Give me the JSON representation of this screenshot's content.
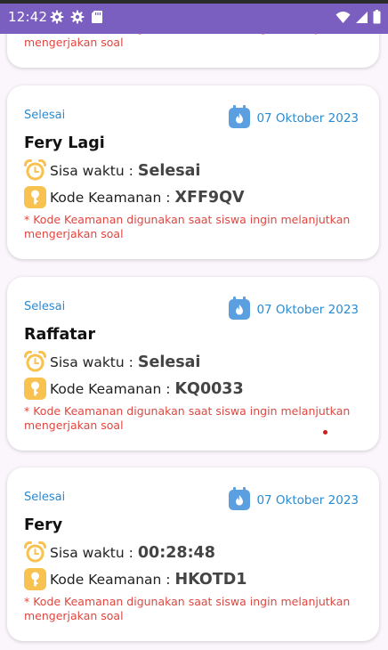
{
  "status_bar": {
    "time": "12:42",
    "left_icons": [
      "gear-icon",
      "gear-icon",
      "sd-card-icon"
    ],
    "right_icons": [
      "wifi-icon",
      "signal-icon",
      "battery-icon"
    ],
    "background": "#7b5fc0"
  },
  "partial_card": {
    "note": "* Kode Keamanan digunakan saat siswa ingin melanjutkan mengerjakan soal"
  },
  "cards": [
    {
      "status": "Selesai",
      "date": "07 Oktober 2023",
      "name": "Fery Lagi",
      "time_label": "Sisa waktu : ",
      "time_value": "Selesai",
      "code_label": "Kode Keamanan : ",
      "code_value": "XFF9QV",
      "note": "* Kode Keamanan digunakan saat siswa ingin melanjutkan mengerjakan soal"
    },
    {
      "status": "Selesai",
      "date": "07 Oktober 2023",
      "name": "Raffatar",
      "time_label": "Sisa waktu : ",
      "time_value": "Selesai",
      "code_label": "Kode Keamanan : ",
      "code_value": "KQ0033",
      "note": "* Kode Keamanan digunakan saat siswa ingin melanjutkan mengerjakan soal"
    },
    {
      "status": "Selesai",
      "date": "07 Oktober 2023",
      "name": "Fery",
      "time_label": "Sisa waktu : ",
      "time_value": "00:28:48",
      "code_label": "Kode Keamanan : ",
      "code_value": "HKOTD1",
      "note": "* Kode Keamanan digunakan saat siswa ingin melanjutkan mengerjakan soal"
    }
  ],
  "colors": {
    "accent_blue": "#2a8bd1",
    "note_red": "#e0463f",
    "icon_yellow": "#f7c250",
    "calendar_blue": "#5b9fe0"
  }
}
